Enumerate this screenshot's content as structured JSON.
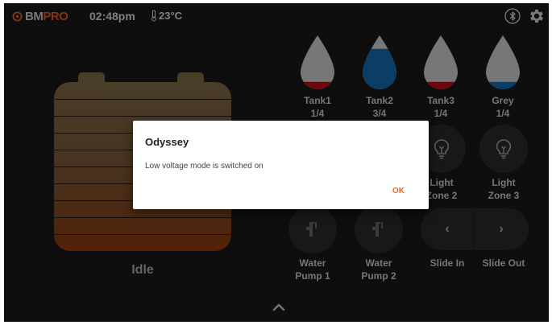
{
  "status_bar": {
    "brand_part1": "BM",
    "brand_part2": "PRO",
    "time": "02:48pm",
    "temperature": "23°C",
    "icons": [
      "thermometer-icon",
      "bluetooth-icon",
      "gear-icon"
    ]
  },
  "battery": {
    "state": "Idle"
  },
  "tanks": [
    {
      "name": "Tank1",
      "level": "1/4",
      "fill_fraction": 0.25,
      "color": "#c4111b"
    },
    {
      "name": "Tank2",
      "level": "3/4",
      "fill_fraction": 0.75,
      "color": "#1670b7"
    },
    {
      "name": "Tank3",
      "level": "1/4",
      "fill_fraction": 0.25,
      "color": "#c4111b"
    },
    {
      "name": "Grey",
      "level": "1/4",
      "fill_fraction": 0.25,
      "color": "#1670b7"
    }
  ],
  "controls": {
    "light_zone_2": "Light Zone 2",
    "light_zone_3": "Light Zone 3",
    "water_pump_1": "Water Pump 1",
    "water_pump_2": "Water Pump 2",
    "slide_in": "Slide In",
    "slide_out": "Slide Out",
    "slide_in_glyph": "‹",
    "slide_out_glyph": "›"
  },
  "dialog": {
    "title": "Odyssey",
    "message": "Low voltage mode is switched on",
    "ok_label": "OK"
  },
  "colors": {
    "accent": "#ea6a37",
    "background": "#1a1a1a"
  }
}
